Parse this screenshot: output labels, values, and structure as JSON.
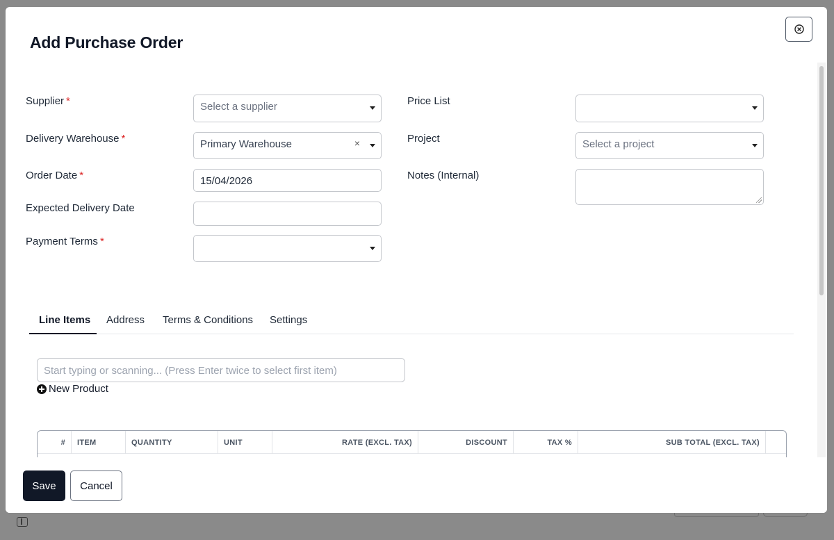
{
  "modal": {
    "title": "Add Purchase Order"
  },
  "form": {
    "supplier": {
      "label": "Supplier",
      "required": "*",
      "placeholder": "Select a supplier"
    },
    "delivery_warehouse": {
      "label": "Delivery Warehouse",
      "required": "*",
      "value": "Primary Warehouse",
      "clear": "×"
    },
    "order_date": {
      "label": "Order Date",
      "required": "*",
      "value": "15/04/2026"
    },
    "expected_delivery_date": {
      "label": "Expected Delivery Date",
      "value": ""
    },
    "payment_terms": {
      "label": "Payment Terms",
      "required": "*",
      "value": ""
    },
    "price_list": {
      "label": "Price List",
      "value": ""
    },
    "project": {
      "label": "Project",
      "placeholder": "Select a project"
    },
    "notes_internal": {
      "label": "Notes (Internal)",
      "value": ""
    }
  },
  "tabs": [
    {
      "label": "Line Items",
      "active": true
    },
    {
      "label": "Address",
      "active": false
    },
    {
      "label": "Terms & Conditions",
      "active": false
    },
    {
      "label": "Settings",
      "active": false
    }
  ],
  "line_items": {
    "search_placeholder": "Start typing or scanning... (Press Enter twice to select first item)",
    "new_product_label": "New Product",
    "columns": [
      "#",
      "ITEM",
      "QUANTITY",
      "UNIT",
      "RATE (EXCL. TAX)",
      "DISCOUNT",
      "TAX %",
      "SUB TOTAL (EXCL. TAX)"
    ]
  },
  "footer": {
    "save_label": "Save",
    "cancel_label": "Cancel"
  },
  "icons": {
    "close": "close-circle-icon",
    "caret": "caret-down-icon",
    "add": "plus-circle-icon",
    "sidebar_toggle": "sidebar-toggle-icon"
  },
  "colors": {
    "primary": "#111827",
    "required": "#dc2626",
    "backdrop": "#8a8a8a"
  }
}
